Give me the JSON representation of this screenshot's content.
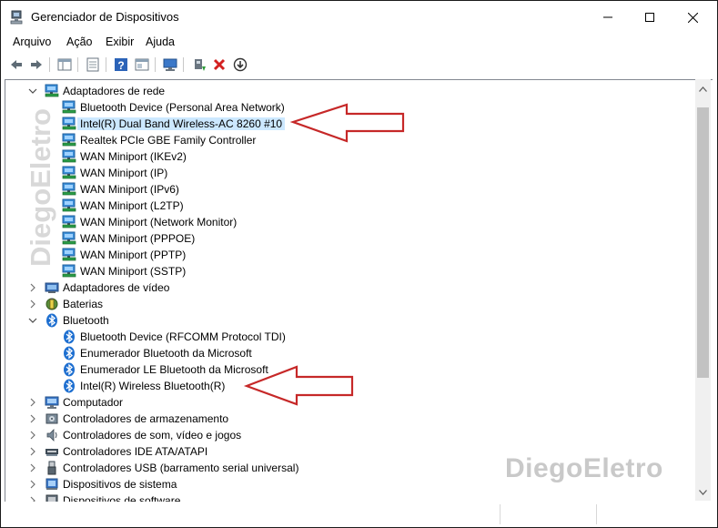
{
  "window": {
    "title": "Gerenciador de Dispositivos",
    "controls": {
      "minimize": "─",
      "maximize": "☐",
      "close": "✕"
    }
  },
  "menu": [
    "Arquivo",
    "Ação",
    "Exibir",
    "Ajuda"
  ],
  "toolbar": {
    "icons": [
      "back-arrow-icon",
      "forward-arrow-icon",
      "show-hide-console-tree-icon",
      "properties-icon",
      "help-icon",
      "view-icon",
      "monitor-icon",
      "update-driver-icon",
      "uninstall-device-icon",
      "disable-device-icon"
    ]
  },
  "tree": {
    "categories": [
      {
        "label": "Adaptadores de rede",
        "expanded": true,
        "icon": "network-adapter-icon",
        "children": [
          {
            "label": "Bluetooth Device (Personal Area Network)",
            "icon": "network-adapter-icon"
          },
          {
            "label": "Intel(R) Dual Band Wireless-AC 8260 #10",
            "icon": "network-adapter-icon",
            "selected": true
          },
          {
            "label": "Realtek PCIe GBE Family Controller",
            "icon": "network-adapter-icon"
          },
          {
            "label": "WAN Miniport (IKEv2)",
            "icon": "network-adapter-icon"
          },
          {
            "label": "WAN Miniport (IP)",
            "icon": "network-adapter-icon"
          },
          {
            "label": "WAN Miniport (IPv6)",
            "icon": "network-adapter-icon"
          },
          {
            "label": "WAN Miniport (L2TP)",
            "icon": "network-adapter-icon"
          },
          {
            "label": "WAN Miniport (Network Monitor)",
            "icon": "network-adapter-icon"
          },
          {
            "label": "WAN Miniport (PPPOE)",
            "icon": "network-adapter-icon"
          },
          {
            "label": "WAN Miniport (PPTP)",
            "icon": "network-adapter-icon"
          },
          {
            "label": "WAN Miniport (SSTP)",
            "icon": "network-adapter-icon"
          }
        ]
      },
      {
        "label": "Adaptadores de vídeo",
        "expanded": false,
        "icon": "display-adapter-icon"
      },
      {
        "label": "Baterias",
        "expanded": false,
        "icon": "battery-icon"
      },
      {
        "label": "Bluetooth",
        "expanded": true,
        "icon": "bluetooth-icon",
        "children": [
          {
            "label": "Bluetooth Device (RFCOMM Protocol TDI)",
            "icon": "bluetooth-icon"
          },
          {
            "label": "Enumerador Bluetooth da Microsoft",
            "icon": "bluetooth-icon"
          },
          {
            "label": "Enumerador LE Bluetooth da Microsoft",
            "icon": "bluetooth-icon"
          },
          {
            "label": "Intel(R) Wireless Bluetooth(R)",
            "icon": "bluetooth-icon"
          }
        ]
      },
      {
        "label": "Computador",
        "expanded": false,
        "icon": "computer-icon"
      },
      {
        "label": "Controladores de armazenamento",
        "expanded": false,
        "icon": "storage-controller-icon"
      },
      {
        "label": "Controladores de som, vídeo e jogos",
        "expanded": false,
        "icon": "sound-icon"
      },
      {
        "label": "Controladores IDE ATA/ATAPI",
        "expanded": false,
        "icon": "ide-controller-icon"
      },
      {
        "label": "Controladores USB (barramento serial universal)",
        "expanded": false,
        "icon": "usb-icon"
      },
      {
        "label": "Dispositivos de sistema",
        "expanded": false,
        "icon": "system-devices-icon"
      },
      {
        "label": "Dispositivos de software",
        "expanded": false,
        "icon": "software-devices-icon"
      }
    ]
  },
  "watermark": "DiegoEletro",
  "colors": {
    "selection": "#cce8ff",
    "arrow": "#c62828",
    "watermark": "#c9c9c9",
    "bluetooth": "#1e6fd0",
    "network": "#3c8fd8"
  }
}
